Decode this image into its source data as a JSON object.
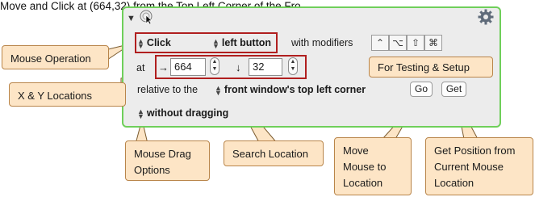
{
  "action": {
    "title": "Move and Click at (664,32) from the Top Left Corner of the Fro...",
    "operation": "Click",
    "button": "left button",
    "with_modifiers_label": "with modifiers",
    "modifiers": [
      "⌃",
      "⌥",
      "⇧",
      "⌘"
    ],
    "at_label": "at",
    "x_arrow": "→",
    "x_value": "664",
    "y_arrow": "↓",
    "y_value": "32",
    "relative_label": "relative to the",
    "relative_to": "front window's top left corner",
    "dragging": "without dragging",
    "go_label": "Go",
    "get_label": "Get"
  },
  "callouts": {
    "mouse_operation": "Mouse Operation",
    "xy_locations": "X & Y Locations",
    "testing_setup": "For Testing & Setup",
    "mouse_drag": "Mouse Drag Options",
    "search_location": "Search Location",
    "move_mouse": "Move Mouse to Location",
    "get_position": "Get Position from Current Mouse Location"
  },
  "colors": {
    "panel_border": "#6fcf5a",
    "highlight_border": "#b01f1f",
    "callout_fill": "#fde5c6"
  },
  "icons": [
    "disclosure-triangle-icon",
    "mouse-click-icon",
    "gear-icon"
  ]
}
